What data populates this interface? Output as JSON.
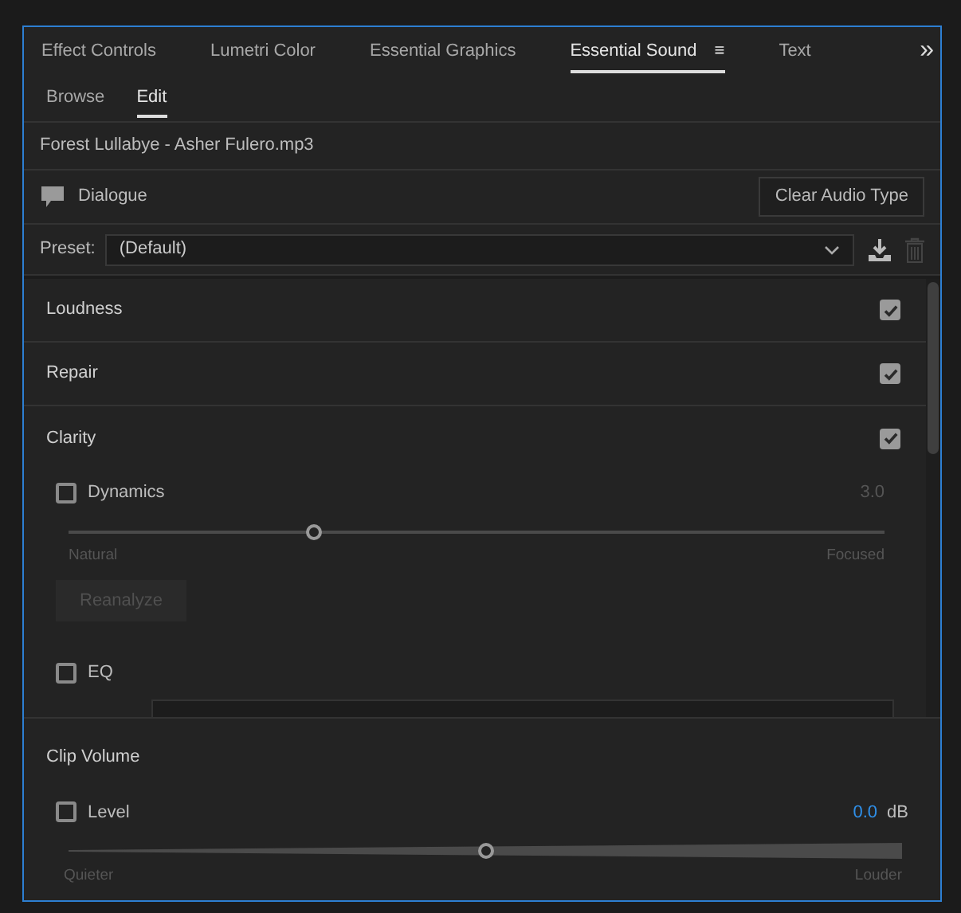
{
  "tabs": [
    {
      "label": "Effect Controls",
      "selected": false
    },
    {
      "label": "Lumetri Color",
      "selected": false
    },
    {
      "label": "Essential Graphics",
      "selected": false
    },
    {
      "label": "Essential Sound",
      "selected": true,
      "menu": "≡"
    },
    {
      "label": "Text",
      "selected": false
    }
  ],
  "overflow": "»",
  "subtabs": [
    {
      "label": "Browse",
      "selected": false
    },
    {
      "label": "Edit",
      "selected": true
    }
  ],
  "clip_name": "Forest Lullabye - Asher Fulero.mp3",
  "audio_type": {
    "label": "Dialogue",
    "button": "Clear Audio Type"
  },
  "preset": {
    "label": "Preset:",
    "value": "(Default)"
  },
  "sections": [
    {
      "title": "Loudness",
      "checked": true
    },
    {
      "title": "Repair",
      "checked": true
    },
    {
      "title": "Clarity",
      "checked": true,
      "controls": [
        {
          "kind": "slider",
          "label": "Dynamics",
          "checked": false,
          "value": "3.0",
          "level": 0.3,
          "min_label": "Natural",
          "max_label": "Focused",
          "button": "Reanalyze",
          "button_disabled": true
        },
        {
          "kind": "dropdown",
          "label": "EQ",
          "checked": false
        }
      ]
    }
  ],
  "clip_volume": {
    "title": "Clip Volume",
    "label": "Level",
    "checked": false,
    "value": "0.0",
    "unit": "dB",
    "level": 0.5,
    "min_label": "Quieter",
    "max_label": "Louder"
  }
}
